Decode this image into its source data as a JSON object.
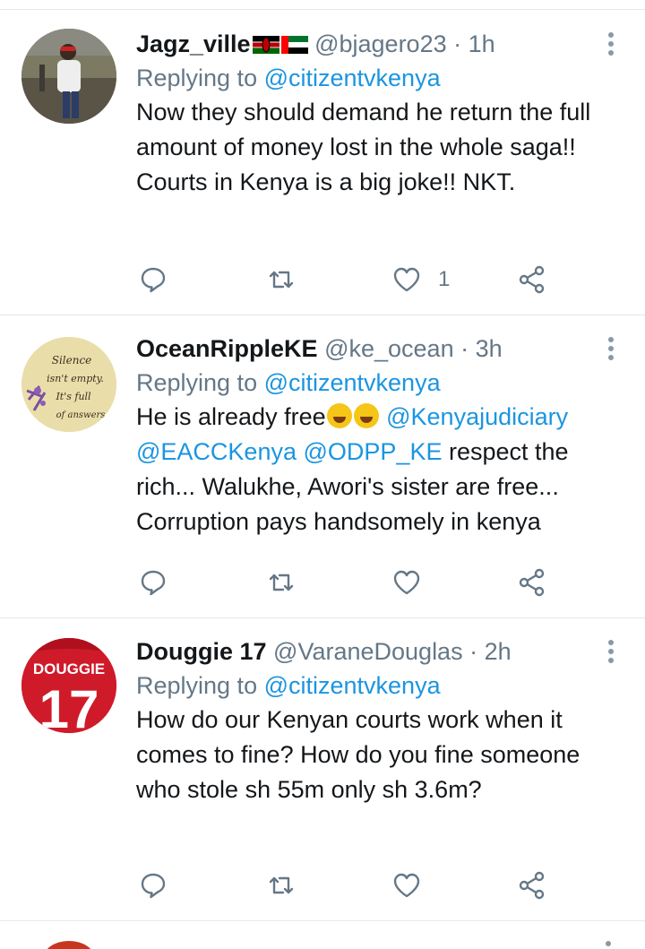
{
  "tweets": [
    {
      "name": "Jagz_ville",
      "handle": "@bjagero23",
      "time": "· 1h",
      "replying_prefix": "Replying to ",
      "replying_to": "@citizentvkenya",
      "text": "Now they should demand he return the full amount of money lost in the whole saga!! Courts in Kenya is a big joke!! NKT.",
      "like_count": "1",
      "avatar": "person-photo"
    },
    {
      "name": "OceanRippleKE",
      "handle": "@ke_ocean",
      "time": "· 3h",
      "replying_prefix": "Replying to ",
      "replying_to": "@citizentvkenya",
      "text_a": "He is already free",
      "mention_1": "@Kenyajudiciary",
      "mention_2": "@EACCKenya",
      "mention_3": "@ODPP_KE",
      "text_b": " respect the rich... Walukhe, Awori's sister are free... Corruption pays handsomely in kenya",
      "like_count": "",
      "avatar_lines": [
        "Silence",
        "isn't empty.",
        "It's full",
        "of answers"
      ]
    },
    {
      "name": "Douggie 17",
      "handle": "@VaraneDouglas",
      "time": "· 2h",
      "replying_prefix": "Replying to ",
      "replying_to": "@citizentvkenya",
      "text": "How do our Kenyan courts work when it comes to fine? How do you fine someone who stole sh 55m only sh 3.6m?",
      "like_count": "",
      "jersey_name": "DOUGGIE",
      "jersey_number": "17"
    }
  ],
  "colors": {
    "link": "#1b95e0",
    "secondary": "#657786",
    "divider": "#e1e8ed"
  },
  "icons": [
    "reply-icon",
    "retweet-icon",
    "like-icon",
    "share-icon",
    "more-icon"
  ]
}
